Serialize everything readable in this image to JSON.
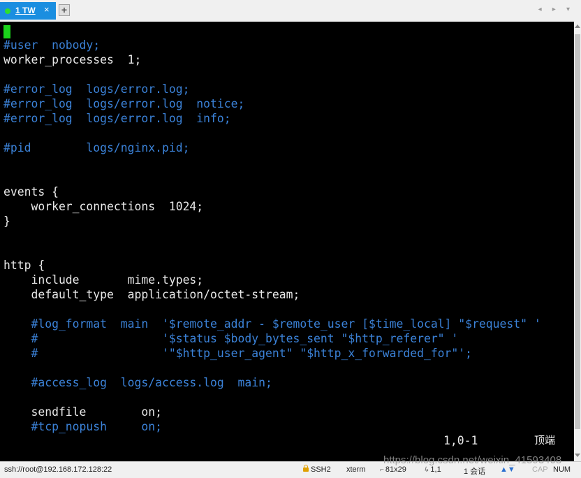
{
  "tabbar": {
    "tab_label": "1 TW",
    "tab_close": "×",
    "new_tab": "+",
    "nav_arrows": "◂ ▸ ▾"
  },
  "terminal": {
    "lines": [
      {
        "text": "",
        "kind": "cursor"
      },
      {
        "text": "#user  nobody;",
        "kind": "comment"
      },
      {
        "text": "worker_processes  1;",
        "kind": "normal"
      },
      {
        "text": "",
        "kind": "normal"
      },
      {
        "text": "#error_log  logs/error.log;",
        "kind": "comment"
      },
      {
        "text": "#error_log  logs/error.log  notice;",
        "kind": "comment"
      },
      {
        "text": "#error_log  logs/error.log  info;",
        "kind": "comment"
      },
      {
        "text": "",
        "kind": "normal"
      },
      {
        "text": "#pid        logs/nginx.pid;",
        "kind": "comment"
      },
      {
        "text": "",
        "kind": "normal"
      },
      {
        "text": "",
        "kind": "normal"
      },
      {
        "text": "events {",
        "kind": "normal"
      },
      {
        "text": "    worker_connections  1024;",
        "kind": "normal"
      },
      {
        "text": "}",
        "kind": "normal"
      },
      {
        "text": "",
        "kind": "normal"
      },
      {
        "text": "",
        "kind": "normal"
      },
      {
        "text": "http {",
        "kind": "normal"
      },
      {
        "text": "    include       mime.types;",
        "kind": "normal"
      },
      {
        "text": "    default_type  application/octet-stream;",
        "kind": "normal"
      },
      {
        "text": "",
        "kind": "normal"
      },
      {
        "text": "    #log_format  main  '$remote_addr - $remote_user [$time_local] \"$request\" '",
        "kind": "comment"
      },
      {
        "text": "    #                  '$status $body_bytes_sent \"$http_referer\" '",
        "kind": "comment"
      },
      {
        "text": "    #                  '\"$http_user_agent\" \"$http_x_forwarded_for\"';",
        "kind": "comment"
      },
      {
        "text": "",
        "kind": "normal"
      },
      {
        "text": "    #access_log  logs/access.log  main;",
        "kind": "comment"
      },
      {
        "text": "",
        "kind": "normal"
      },
      {
        "text": "    sendfile        on;",
        "kind": "normal"
      },
      {
        "text": "    #tcp_nopush     on;",
        "kind": "comment"
      }
    ],
    "ruler_position": "1,0-1",
    "ruler_top": "顶端"
  },
  "statusbar": {
    "connection": "ssh://root@192.168.172.128:22",
    "protocol": "SSH2",
    "terminal_type": "xterm",
    "size": "81x29",
    "cursor_pos": "1,1",
    "sessions": "1 会话",
    "caps": "CAP",
    "num": "NUM"
  },
  "watermark": "https://blog.csdn.net/weixin_41593408",
  "colors": {
    "tab_active": "#1a8ee0",
    "cursor": "#1bd31b",
    "comment": "#3b82d8",
    "text": "#e8e8e8",
    "background": "#000000"
  },
  "icons": [
    "tab-status-dot",
    "new-tab-plus-icon",
    "lock-icon",
    "arrow-updown-icon"
  ]
}
